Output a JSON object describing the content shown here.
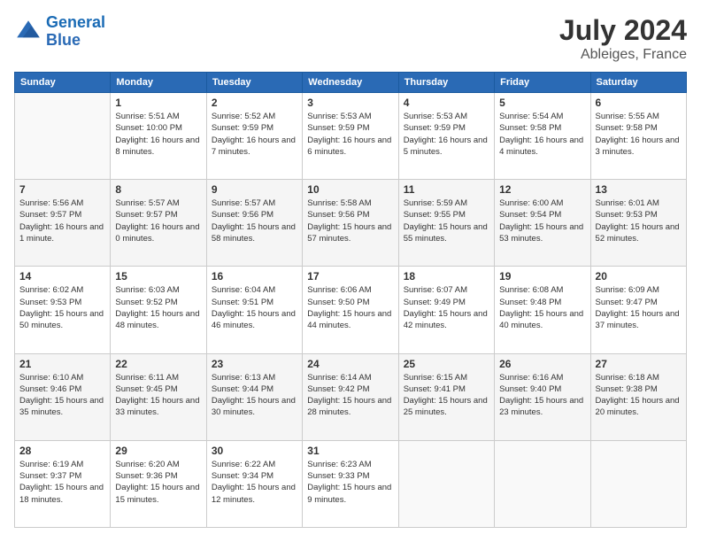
{
  "header": {
    "logo_line1": "General",
    "logo_line2": "Blue",
    "main_title": "July 2024",
    "sub_title": "Ableiges, France"
  },
  "weekdays": [
    "Sunday",
    "Monday",
    "Tuesday",
    "Wednesday",
    "Thursday",
    "Friday",
    "Saturday"
  ],
  "weeks": [
    [
      {
        "day": "",
        "sunrise": "",
        "sunset": "",
        "daylight": ""
      },
      {
        "day": "1",
        "sunrise": "Sunrise: 5:51 AM",
        "sunset": "Sunset: 10:00 PM",
        "daylight": "Daylight: 16 hours and 8 minutes."
      },
      {
        "day": "2",
        "sunrise": "Sunrise: 5:52 AM",
        "sunset": "Sunset: 9:59 PM",
        "daylight": "Daylight: 16 hours and 7 minutes."
      },
      {
        "day": "3",
        "sunrise": "Sunrise: 5:53 AM",
        "sunset": "Sunset: 9:59 PM",
        "daylight": "Daylight: 16 hours and 6 minutes."
      },
      {
        "day": "4",
        "sunrise": "Sunrise: 5:53 AM",
        "sunset": "Sunset: 9:59 PM",
        "daylight": "Daylight: 16 hours and 5 minutes."
      },
      {
        "day": "5",
        "sunrise": "Sunrise: 5:54 AM",
        "sunset": "Sunset: 9:58 PM",
        "daylight": "Daylight: 16 hours and 4 minutes."
      },
      {
        "day": "6",
        "sunrise": "Sunrise: 5:55 AM",
        "sunset": "Sunset: 9:58 PM",
        "daylight": "Daylight: 16 hours and 3 minutes."
      }
    ],
    [
      {
        "day": "7",
        "sunrise": "Sunrise: 5:56 AM",
        "sunset": "Sunset: 9:57 PM",
        "daylight": "Daylight: 16 hours and 1 minute."
      },
      {
        "day": "8",
        "sunrise": "Sunrise: 5:57 AM",
        "sunset": "Sunset: 9:57 PM",
        "daylight": "Daylight: 16 hours and 0 minutes."
      },
      {
        "day": "9",
        "sunrise": "Sunrise: 5:57 AM",
        "sunset": "Sunset: 9:56 PM",
        "daylight": "Daylight: 15 hours and 58 minutes."
      },
      {
        "day": "10",
        "sunrise": "Sunrise: 5:58 AM",
        "sunset": "Sunset: 9:56 PM",
        "daylight": "Daylight: 15 hours and 57 minutes."
      },
      {
        "day": "11",
        "sunrise": "Sunrise: 5:59 AM",
        "sunset": "Sunset: 9:55 PM",
        "daylight": "Daylight: 15 hours and 55 minutes."
      },
      {
        "day": "12",
        "sunrise": "Sunrise: 6:00 AM",
        "sunset": "Sunset: 9:54 PM",
        "daylight": "Daylight: 15 hours and 53 minutes."
      },
      {
        "day": "13",
        "sunrise": "Sunrise: 6:01 AM",
        "sunset": "Sunset: 9:53 PM",
        "daylight": "Daylight: 15 hours and 52 minutes."
      }
    ],
    [
      {
        "day": "14",
        "sunrise": "Sunrise: 6:02 AM",
        "sunset": "Sunset: 9:53 PM",
        "daylight": "Daylight: 15 hours and 50 minutes."
      },
      {
        "day": "15",
        "sunrise": "Sunrise: 6:03 AM",
        "sunset": "Sunset: 9:52 PM",
        "daylight": "Daylight: 15 hours and 48 minutes."
      },
      {
        "day": "16",
        "sunrise": "Sunrise: 6:04 AM",
        "sunset": "Sunset: 9:51 PM",
        "daylight": "Daylight: 15 hours and 46 minutes."
      },
      {
        "day": "17",
        "sunrise": "Sunrise: 6:06 AM",
        "sunset": "Sunset: 9:50 PM",
        "daylight": "Daylight: 15 hours and 44 minutes."
      },
      {
        "day": "18",
        "sunrise": "Sunrise: 6:07 AM",
        "sunset": "Sunset: 9:49 PM",
        "daylight": "Daylight: 15 hours and 42 minutes."
      },
      {
        "day": "19",
        "sunrise": "Sunrise: 6:08 AM",
        "sunset": "Sunset: 9:48 PM",
        "daylight": "Daylight: 15 hours and 40 minutes."
      },
      {
        "day": "20",
        "sunrise": "Sunrise: 6:09 AM",
        "sunset": "Sunset: 9:47 PM",
        "daylight": "Daylight: 15 hours and 37 minutes."
      }
    ],
    [
      {
        "day": "21",
        "sunrise": "Sunrise: 6:10 AM",
        "sunset": "Sunset: 9:46 PM",
        "daylight": "Daylight: 15 hours and 35 minutes."
      },
      {
        "day": "22",
        "sunrise": "Sunrise: 6:11 AM",
        "sunset": "Sunset: 9:45 PM",
        "daylight": "Daylight: 15 hours and 33 minutes."
      },
      {
        "day": "23",
        "sunrise": "Sunrise: 6:13 AM",
        "sunset": "Sunset: 9:44 PM",
        "daylight": "Daylight: 15 hours and 30 minutes."
      },
      {
        "day": "24",
        "sunrise": "Sunrise: 6:14 AM",
        "sunset": "Sunset: 9:42 PM",
        "daylight": "Daylight: 15 hours and 28 minutes."
      },
      {
        "day": "25",
        "sunrise": "Sunrise: 6:15 AM",
        "sunset": "Sunset: 9:41 PM",
        "daylight": "Daylight: 15 hours and 25 minutes."
      },
      {
        "day": "26",
        "sunrise": "Sunrise: 6:16 AM",
        "sunset": "Sunset: 9:40 PM",
        "daylight": "Daylight: 15 hours and 23 minutes."
      },
      {
        "day": "27",
        "sunrise": "Sunrise: 6:18 AM",
        "sunset": "Sunset: 9:38 PM",
        "daylight": "Daylight: 15 hours and 20 minutes."
      }
    ],
    [
      {
        "day": "28",
        "sunrise": "Sunrise: 6:19 AM",
        "sunset": "Sunset: 9:37 PM",
        "daylight": "Daylight: 15 hours and 18 minutes."
      },
      {
        "day": "29",
        "sunrise": "Sunrise: 6:20 AM",
        "sunset": "Sunset: 9:36 PM",
        "daylight": "Daylight: 15 hours and 15 minutes."
      },
      {
        "day": "30",
        "sunrise": "Sunrise: 6:22 AM",
        "sunset": "Sunset: 9:34 PM",
        "daylight": "Daylight: 15 hours and 12 minutes."
      },
      {
        "day": "31",
        "sunrise": "Sunrise: 6:23 AM",
        "sunset": "Sunset: 9:33 PM",
        "daylight": "Daylight: 15 hours and 9 minutes."
      },
      {
        "day": "",
        "sunrise": "",
        "sunset": "",
        "daylight": ""
      },
      {
        "day": "",
        "sunrise": "",
        "sunset": "",
        "daylight": ""
      },
      {
        "day": "",
        "sunrise": "",
        "sunset": "",
        "daylight": ""
      }
    ]
  ]
}
